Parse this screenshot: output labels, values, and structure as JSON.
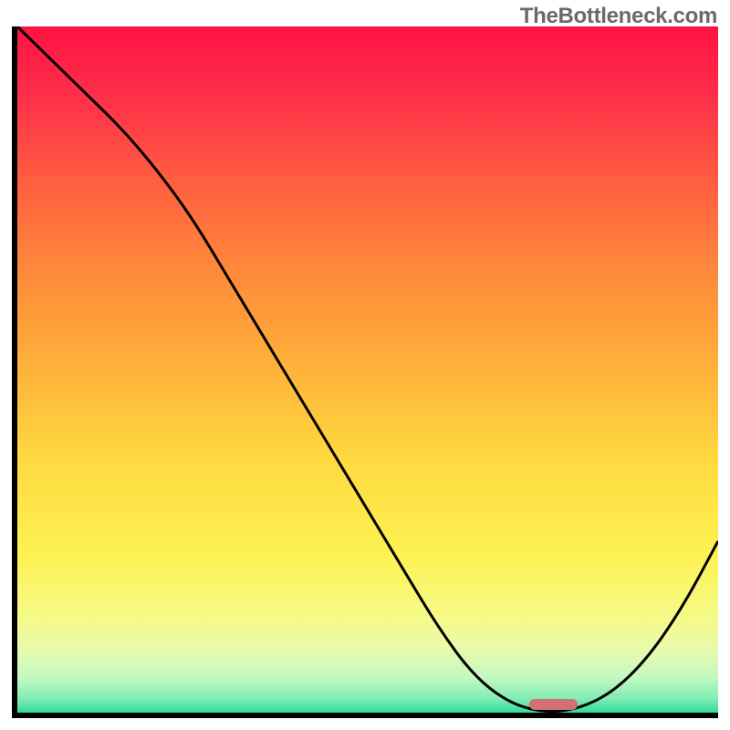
{
  "watermark": "TheBottleneck.com",
  "chart_data": {
    "type": "line",
    "title": "",
    "xlabel": "",
    "ylabel": "",
    "xlim": [
      0,
      100
    ],
    "ylim": [
      0,
      100
    ],
    "x": [
      0,
      5,
      10,
      15,
      20,
      25,
      30,
      35,
      40,
      45,
      50,
      55,
      60,
      65,
      70,
      75,
      80,
      85,
      90,
      95,
      100
    ],
    "values": [
      100,
      95,
      90,
      85,
      79,
      72,
      63.5,
      55,
      46.5,
      38,
      29.5,
      21,
      12.5,
      5.5,
      1.5,
      0,
      0.5,
      3,
      8,
      15.5,
      25
    ],
    "gradient_stops": [
      {
        "pos": 0.0,
        "color": "#ff1243"
      },
      {
        "pos": 0.1,
        "color": "#ff2f4a"
      },
      {
        "pos": 0.23,
        "color": "#ff6040"
      },
      {
        "pos": 0.36,
        "color": "#ff8a3a"
      },
      {
        "pos": 0.5,
        "color": "#ffb23a"
      },
      {
        "pos": 0.63,
        "color": "#fed940"
      },
      {
        "pos": 0.77,
        "color": "#fdf252"
      },
      {
        "pos": 0.86,
        "color": "#f6fa87"
      },
      {
        "pos": 0.91,
        "color": "#e6fbae"
      },
      {
        "pos": 0.95,
        "color": "#c1f8c0"
      },
      {
        "pos": 0.98,
        "color": "#7fedb4"
      },
      {
        "pos": 1.0,
        "color": "#30d99e"
      }
    ],
    "marker": {
      "x_start": 73,
      "x_end": 80,
      "y": 0,
      "color": "#d27074"
    }
  }
}
